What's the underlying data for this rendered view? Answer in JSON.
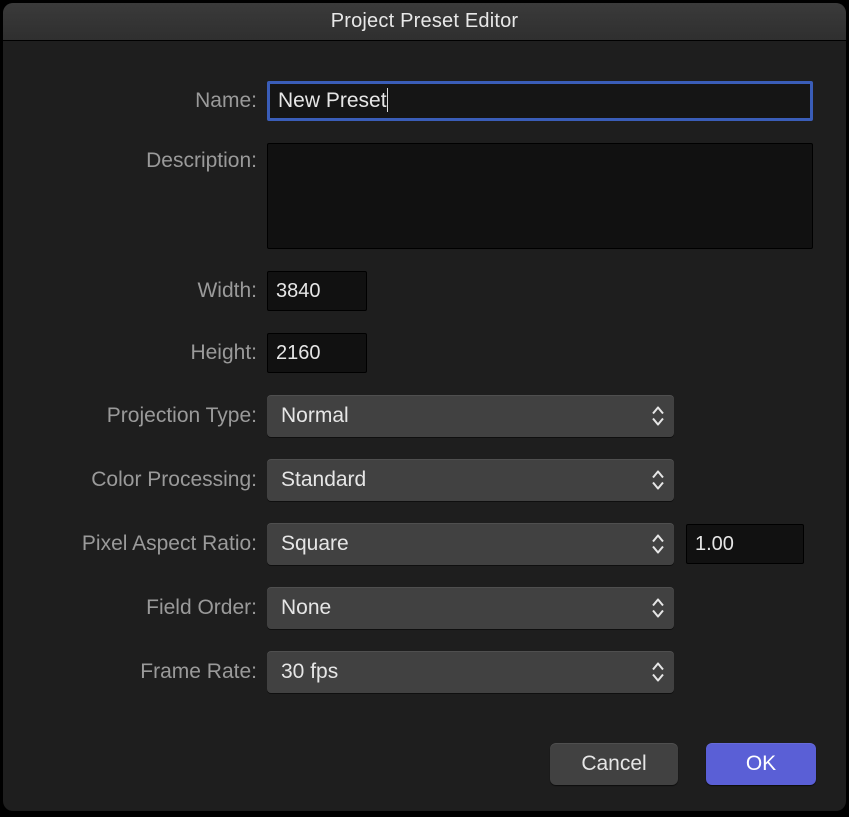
{
  "window": {
    "title": "Project Preset Editor"
  },
  "labels": {
    "name": "Name:",
    "description": "Description:",
    "width": "Width:",
    "height": "Height:",
    "projection_type": "Projection Type:",
    "color_processing": "Color Processing:",
    "pixel_aspect_ratio": "Pixel Aspect Ratio:",
    "field_order": "Field Order:",
    "frame_rate": "Frame Rate:"
  },
  "values": {
    "name": "New Preset",
    "description": "",
    "width": "3840",
    "height": "2160",
    "projection_type": "Normal",
    "color_processing": "Standard",
    "pixel_aspect_ratio": "Square",
    "pixel_aspect_value": "1.00",
    "field_order": "None",
    "frame_rate": "30 fps"
  },
  "buttons": {
    "cancel": "Cancel",
    "ok": "OK"
  }
}
